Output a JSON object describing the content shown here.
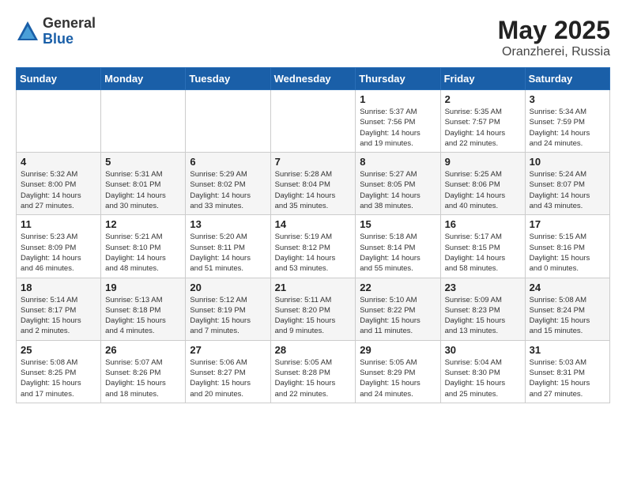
{
  "logo": {
    "general": "General",
    "blue": "Blue"
  },
  "title": {
    "month_year": "May 2025",
    "location": "Oranzherei, Russia"
  },
  "weekdays": [
    "Sunday",
    "Monday",
    "Tuesday",
    "Wednesday",
    "Thursday",
    "Friday",
    "Saturday"
  ],
  "weeks": [
    [
      {
        "day": "",
        "info": ""
      },
      {
        "day": "",
        "info": ""
      },
      {
        "day": "",
        "info": ""
      },
      {
        "day": "",
        "info": ""
      },
      {
        "day": "1",
        "info": "Sunrise: 5:37 AM\nSunset: 7:56 PM\nDaylight: 14 hours\nand 19 minutes."
      },
      {
        "day": "2",
        "info": "Sunrise: 5:35 AM\nSunset: 7:57 PM\nDaylight: 14 hours\nand 22 minutes."
      },
      {
        "day": "3",
        "info": "Sunrise: 5:34 AM\nSunset: 7:59 PM\nDaylight: 14 hours\nand 24 minutes."
      }
    ],
    [
      {
        "day": "4",
        "info": "Sunrise: 5:32 AM\nSunset: 8:00 PM\nDaylight: 14 hours\nand 27 minutes."
      },
      {
        "day": "5",
        "info": "Sunrise: 5:31 AM\nSunset: 8:01 PM\nDaylight: 14 hours\nand 30 minutes."
      },
      {
        "day": "6",
        "info": "Sunrise: 5:29 AM\nSunset: 8:02 PM\nDaylight: 14 hours\nand 33 minutes."
      },
      {
        "day": "7",
        "info": "Sunrise: 5:28 AM\nSunset: 8:04 PM\nDaylight: 14 hours\nand 35 minutes."
      },
      {
        "day": "8",
        "info": "Sunrise: 5:27 AM\nSunset: 8:05 PM\nDaylight: 14 hours\nand 38 minutes."
      },
      {
        "day": "9",
        "info": "Sunrise: 5:25 AM\nSunset: 8:06 PM\nDaylight: 14 hours\nand 40 minutes."
      },
      {
        "day": "10",
        "info": "Sunrise: 5:24 AM\nSunset: 8:07 PM\nDaylight: 14 hours\nand 43 minutes."
      }
    ],
    [
      {
        "day": "11",
        "info": "Sunrise: 5:23 AM\nSunset: 8:09 PM\nDaylight: 14 hours\nand 46 minutes."
      },
      {
        "day": "12",
        "info": "Sunrise: 5:21 AM\nSunset: 8:10 PM\nDaylight: 14 hours\nand 48 minutes."
      },
      {
        "day": "13",
        "info": "Sunrise: 5:20 AM\nSunset: 8:11 PM\nDaylight: 14 hours\nand 51 minutes."
      },
      {
        "day": "14",
        "info": "Sunrise: 5:19 AM\nSunset: 8:12 PM\nDaylight: 14 hours\nand 53 minutes."
      },
      {
        "day": "15",
        "info": "Sunrise: 5:18 AM\nSunset: 8:14 PM\nDaylight: 14 hours\nand 55 minutes."
      },
      {
        "day": "16",
        "info": "Sunrise: 5:17 AM\nSunset: 8:15 PM\nDaylight: 14 hours\nand 58 minutes."
      },
      {
        "day": "17",
        "info": "Sunrise: 5:15 AM\nSunset: 8:16 PM\nDaylight: 15 hours\nand 0 minutes."
      }
    ],
    [
      {
        "day": "18",
        "info": "Sunrise: 5:14 AM\nSunset: 8:17 PM\nDaylight: 15 hours\nand 2 minutes."
      },
      {
        "day": "19",
        "info": "Sunrise: 5:13 AM\nSunset: 8:18 PM\nDaylight: 15 hours\nand 4 minutes."
      },
      {
        "day": "20",
        "info": "Sunrise: 5:12 AM\nSunset: 8:19 PM\nDaylight: 15 hours\nand 7 minutes."
      },
      {
        "day": "21",
        "info": "Sunrise: 5:11 AM\nSunset: 8:20 PM\nDaylight: 15 hours\nand 9 minutes."
      },
      {
        "day": "22",
        "info": "Sunrise: 5:10 AM\nSunset: 8:22 PM\nDaylight: 15 hours\nand 11 minutes."
      },
      {
        "day": "23",
        "info": "Sunrise: 5:09 AM\nSunset: 8:23 PM\nDaylight: 15 hours\nand 13 minutes."
      },
      {
        "day": "24",
        "info": "Sunrise: 5:08 AM\nSunset: 8:24 PM\nDaylight: 15 hours\nand 15 minutes."
      }
    ],
    [
      {
        "day": "25",
        "info": "Sunrise: 5:08 AM\nSunset: 8:25 PM\nDaylight: 15 hours\nand 17 minutes."
      },
      {
        "day": "26",
        "info": "Sunrise: 5:07 AM\nSunset: 8:26 PM\nDaylight: 15 hours\nand 18 minutes."
      },
      {
        "day": "27",
        "info": "Sunrise: 5:06 AM\nSunset: 8:27 PM\nDaylight: 15 hours\nand 20 minutes."
      },
      {
        "day": "28",
        "info": "Sunrise: 5:05 AM\nSunset: 8:28 PM\nDaylight: 15 hours\nand 22 minutes."
      },
      {
        "day": "29",
        "info": "Sunrise: 5:05 AM\nSunset: 8:29 PM\nDaylight: 15 hours\nand 24 minutes."
      },
      {
        "day": "30",
        "info": "Sunrise: 5:04 AM\nSunset: 8:30 PM\nDaylight: 15 hours\nand 25 minutes."
      },
      {
        "day": "31",
        "info": "Sunrise: 5:03 AM\nSunset: 8:31 PM\nDaylight: 15 hours\nand 27 minutes."
      }
    ]
  ]
}
